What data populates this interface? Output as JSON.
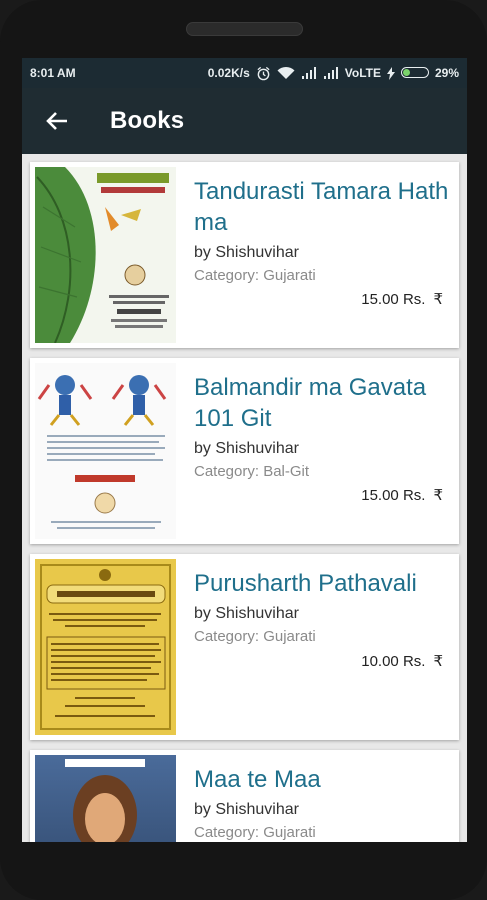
{
  "status": {
    "time": "8:01 AM",
    "speed": "0.02K/s",
    "network": "VoLTE",
    "battery": "29%",
    "battery_level": 0.29
  },
  "appbar": {
    "title": "Books",
    "back_icon": "arrow-left-icon"
  },
  "colors": {
    "appbar": "#1f2c32",
    "statusbar": "#1c2b33",
    "title_text": "#1f6f8b"
  },
  "books": [
    {
      "title": "Tandurasti Tamara Hath ma",
      "author": "by Shishuvihar",
      "category": "Category: Gujarati",
      "price": "15.00 Rs.",
      "currency": "₹"
    },
    {
      "title": "Balmandir ma Gavata 101 Git",
      "author": "by Shishuvihar",
      "category": "Category: Bal-Git",
      "price": "15.00 Rs.",
      "currency": "₹"
    },
    {
      "title": "Purusharth Pathavali",
      "author": "by Shishuvihar",
      "category": "Category: Gujarati",
      "price": "10.00 Rs.",
      "currency": "₹"
    },
    {
      "title": "Maa te Maa",
      "author": "by Shishuvihar",
      "category": "Category: Gujarati",
      "price": "",
      "currency": ""
    }
  ]
}
